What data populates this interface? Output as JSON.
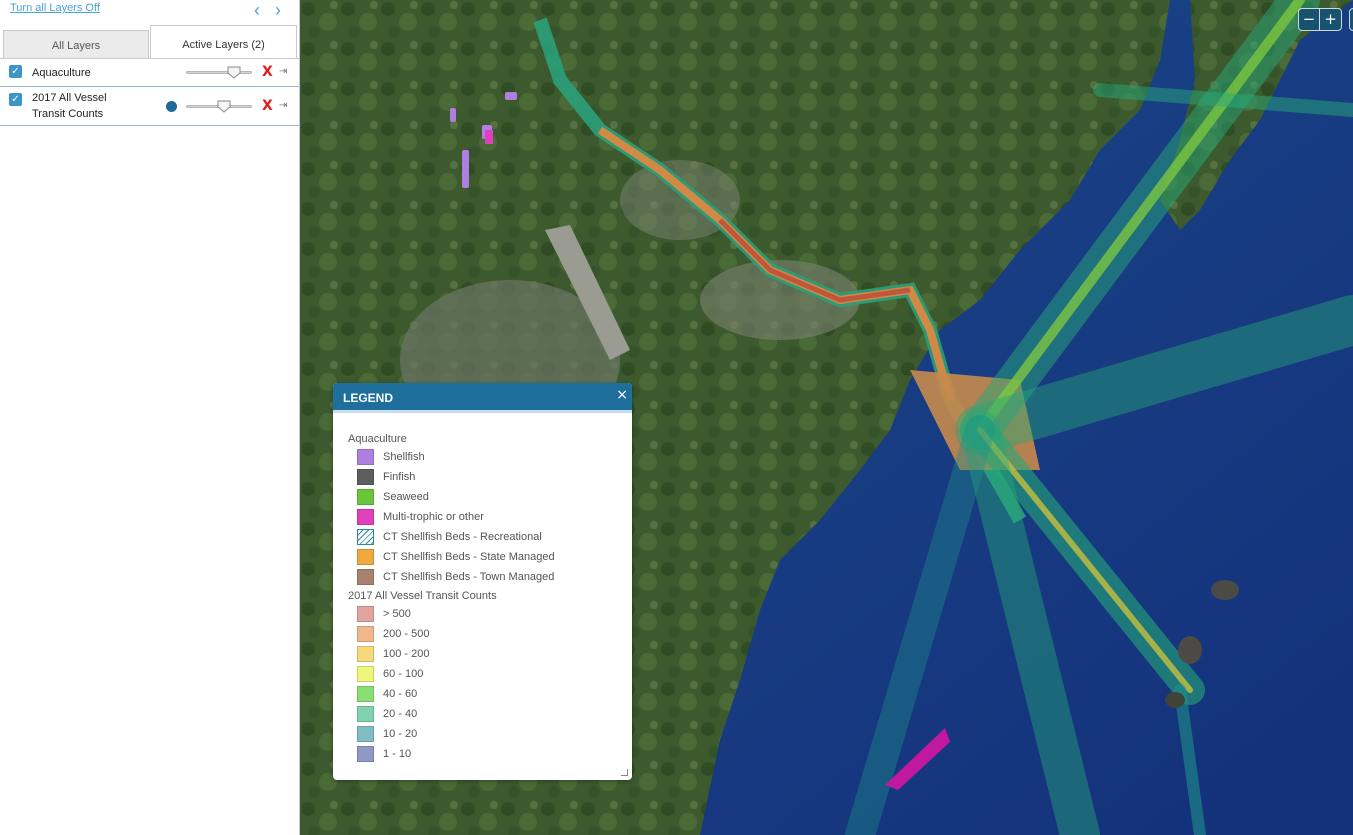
{
  "sidebar": {
    "turn_off_label": "Turn all Layers Off",
    "tabs": [
      {
        "label": "All Layers"
      },
      {
        "label": "Active Layers (2)"
      }
    ],
    "layers": [
      {
        "label": "Aquaculture",
        "checked": true,
        "opacity": 0.7
      },
      {
        "label": "2017 All Vessel Transit Counts",
        "label_line1": "2017 All Vessel",
        "label_line2": "Transit Counts",
        "checked": true,
        "opacity": 0.5
      }
    ]
  },
  "map_controls": {
    "zoom_out": "−",
    "zoom_in": "+"
  },
  "legend": {
    "title": "LEGEND",
    "close": "×",
    "groups": [
      {
        "title": "Aquaculture",
        "items": [
          {
            "label": "Shellfish",
            "color": "#b07ee0"
          },
          {
            "label": "Finfish",
            "color": "#5e5e5e"
          },
          {
            "label": "Seaweed",
            "color": "#6bc53a"
          },
          {
            "label": "Multi-trophic or other",
            "color": "#e23fbd"
          },
          {
            "label": "CT Shellfish Beds - Recreational",
            "color": "hatched"
          },
          {
            "label": "CT Shellfish Beds - State Managed",
            "color": "#efa93d"
          },
          {
            "label": "CT Shellfish Beds - Town Managed",
            "color": "#a88170"
          }
        ]
      },
      {
        "title": "2017 All Vessel Transit Counts",
        "items": [
          {
            "label": "> 500",
            "color": "#e3a39e"
          },
          {
            "label": "200 - 500",
            "color": "#f2b68c"
          },
          {
            "label": "100 - 200",
            "color": "#f6d97c"
          },
          {
            "label": "60 - 100",
            "color": "#eef67c"
          },
          {
            "label": "40 - 60",
            "color": "#89df71"
          },
          {
            "label": "20 - 40",
            "color": "#7fd3b0"
          },
          {
            "label": "10 - 20",
            "color": "#81bcc4"
          },
          {
            "label": "1 - 10",
            "color": "#8e99c6"
          }
        ]
      }
    ]
  }
}
